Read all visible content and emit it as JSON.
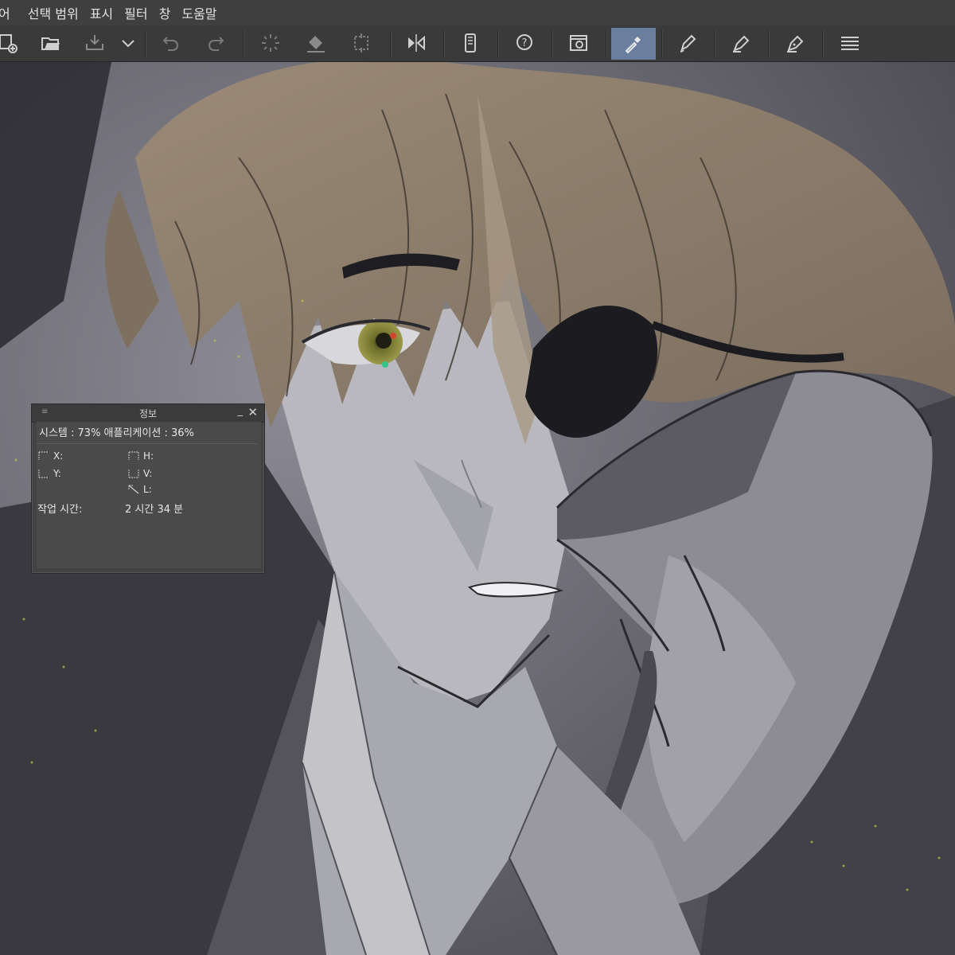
{
  "menu": {
    "items": [
      "어",
      "선택 범위",
      "표시",
      "필터",
      "창",
      "도움말"
    ]
  },
  "toolbar": {
    "buttons": [
      {
        "icon": "new-canvas-icon"
      },
      {
        "icon": "open-folder-icon"
      },
      {
        "icon": "save-icon"
      },
      {
        "icon": "chevron-down-icon"
      },
      {
        "icon": "undo-icon"
      },
      {
        "icon": "redo-icon"
      },
      {
        "icon": "loading-spinner-icon"
      },
      {
        "icon": "fill-bucket-icon"
      },
      {
        "icon": "transform-icon"
      },
      {
        "icon": "flip-horizontal-icon"
      },
      {
        "icon": "smartphone-icon"
      },
      {
        "icon": "help-icon"
      },
      {
        "icon": "navigator-icon"
      },
      {
        "icon": "eyedropper-icon",
        "active": true
      },
      {
        "icon": "pen-icon"
      },
      {
        "icon": "marker-icon"
      },
      {
        "icon": "ink-pen-icon"
      },
      {
        "icon": "menu-icon"
      }
    ],
    "active_color": "#6a7f9e"
  },
  "info_panel": {
    "title": "정보",
    "usage_text": "시스템 : 73%   애플리케이션 : 36%",
    "labels": {
      "x": "X:",
      "y": "Y:",
      "h": "H:",
      "v": "V:",
      "l": "L:"
    },
    "work_time_label": "작업 시간:",
    "work_time_value": "2 시간 34 분"
  },
  "theme": {
    "menubar_bg": "#3f3f3f",
    "toolbar_bg": "#3a3a3a",
    "hair_color": "#8b7b68",
    "skin_color": "#bcbcc2",
    "eye_color": "#8a8a3a"
  }
}
